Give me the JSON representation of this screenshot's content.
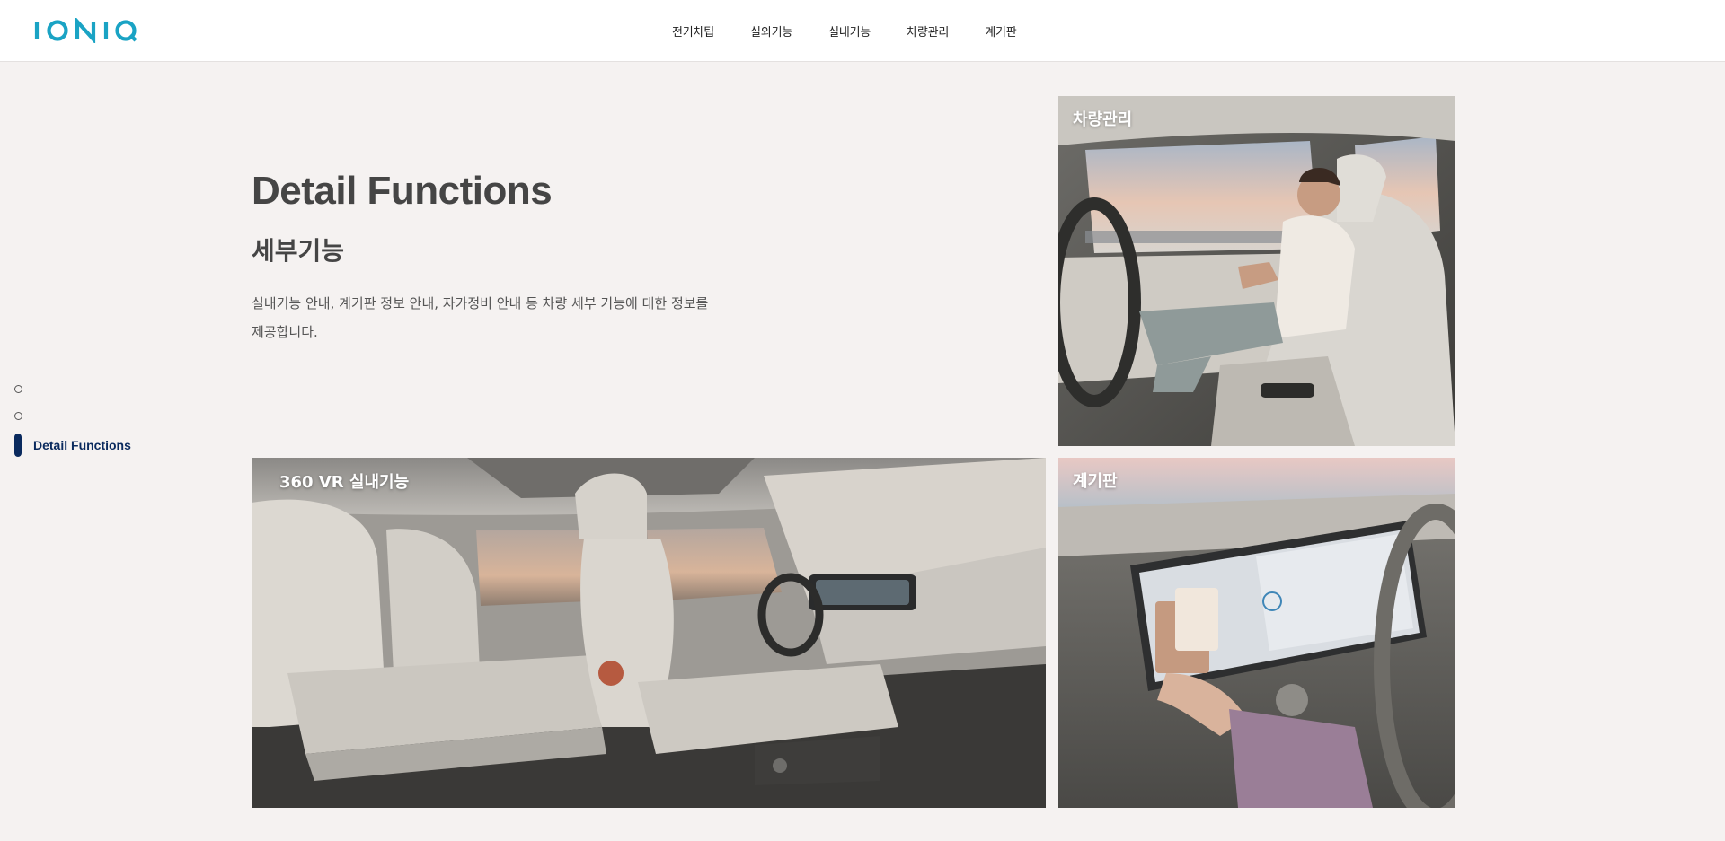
{
  "header": {
    "logo_text": "IONIQ",
    "nav": [
      "전기차팁",
      "실외기능",
      "실내기능",
      "차량관리",
      "계기판"
    ]
  },
  "intro": {
    "title": "Detail Functions",
    "subtitle": "세부기능",
    "description": "실내기능 안내, 계기판 정보 안내, 자가정비 안내 등 차량 세부 기능에 대한 정보를 제공합니다."
  },
  "sidenav": {
    "active_label": "Detail Functions"
  },
  "cards": [
    {
      "label": "차량관리"
    },
    {
      "label": "360 VR 실내기능"
    },
    {
      "label": "계기판"
    }
  ],
  "colors": {
    "brand_teal": "#1aa3c4",
    "active_navy": "#0a2a5e",
    "background": "#f5f2f1"
  }
}
